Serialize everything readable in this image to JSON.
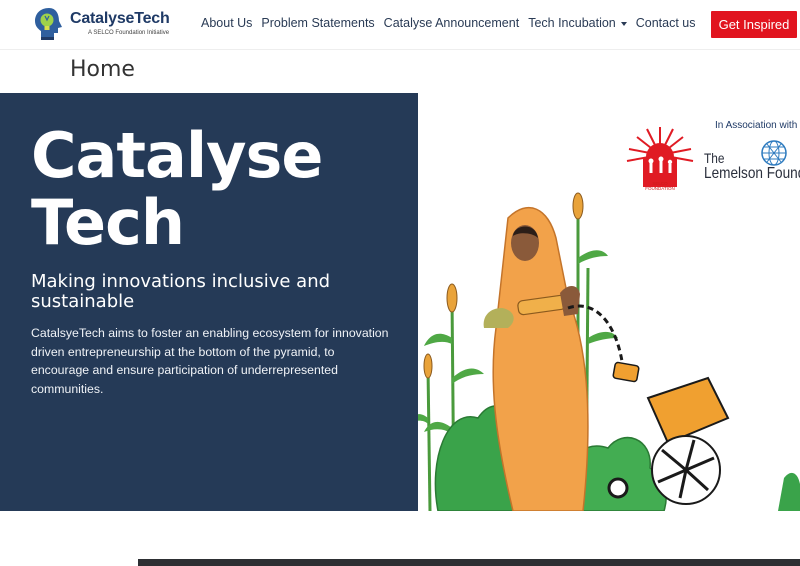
{
  "brand": {
    "name": "CatalyseTech",
    "tagline": "A SELCO Foundation Initiative"
  },
  "nav": {
    "items": [
      {
        "label": "About Us"
      },
      {
        "label": "Problem Statements"
      },
      {
        "label": "Catalyse Announcement"
      },
      {
        "label": "Tech Incubation",
        "has_dropdown": true
      },
      {
        "label": "Contact us"
      }
    ],
    "cta_label": "Get Inspired"
  },
  "page": {
    "title": "Home"
  },
  "hero": {
    "heading_line1": "Catalyse",
    "heading_line2": "Tech",
    "subheading": "Making innovations inclusive and sustainable",
    "description": "CatalsyeTech aims to foster an enabling ecosystem for innovation driven entrepreneurship at the bottom of the pyramid, to encourage and ensure participation of underrepresented communities.",
    "association_label": "In Association with",
    "partner_line1": "The",
    "partner_line2": "Lemelson Foundation",
    "selco_label": "SELCO FOUNDATION"
  },
  "colors": {
    "hero_bg": "#253a57",
    "cta_bg": "#e1141f",
    "brand_blue": "#1f3a66"
  },
  "icons": [
    "lightbulb-head-logo-icon",
    "chevron-down-icon",
    "selco-sun-logo-icon",
    "lemelson-globe-icon"
  ]
}
